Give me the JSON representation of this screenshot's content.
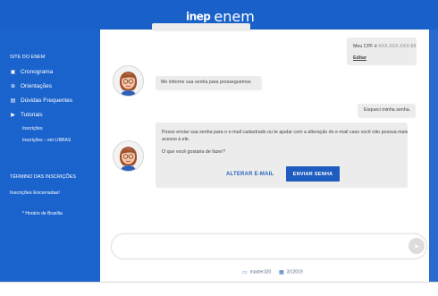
{
  "header": {
    "logo_inep": "inep",
    "logo_enem": "enem"
  },
  "sidebar": {
    "title": "SITE DO ENEM",
    "items": [
      {
        "label": "Cronograma",
        "icon": "calendar-icon"
      },
      {
        "label": "Orientações",
        "icon": "globe-icon"
      },
      {
        "label": "Dúvidas Frequentes",
        "icon": "book-icon"
      },
      {
        "label": "Tutoriais",
        "icon": "video-icon"
      }
    ],
    "subitems": [
      "Inscrições",
      "Inscrições – em LIBRAS"
    ],
    "section2_title": "TÉRMINO DAS INSCRIÇÕES",
    "section2_text": "Inscrições Encerradas!",
    "note": "* Horário de Brasília"
  },
  "chat": {
    "user_cpf_label": "Meu CPF é",
    "user_cpf_value": "XXX.XXX.XXX-69",
    "edit_link": "Editar",
    "bot_msg_1": "Me informe sua senha para prosseguirmos",
    "user_msg_2": "Esqueci minha senha.",
    "bot_msg_2_line1": "Posso enviar sua senha para o e-mail cadastrado ou te ajudar com a alteração do e-mail caso você não possua mais",
    "bot_msg_2_line2": "acesso à ele.",
    "bot_msg_2_question": "O que você gostaria de fazer?",
    "btn_change_email": "ALTERAR E-MAIL",
    "btn_send_password": "ENVIAR SENHA"
  },
  "footer": {
    "item1": "master320",
    "item2": "3/12019"
  },
  "colors": {
    "brand_blue": "#1961c9",
    "bubble_gray": "#ececec",
    "button_blue": "#1f5cbf"
  }
}
